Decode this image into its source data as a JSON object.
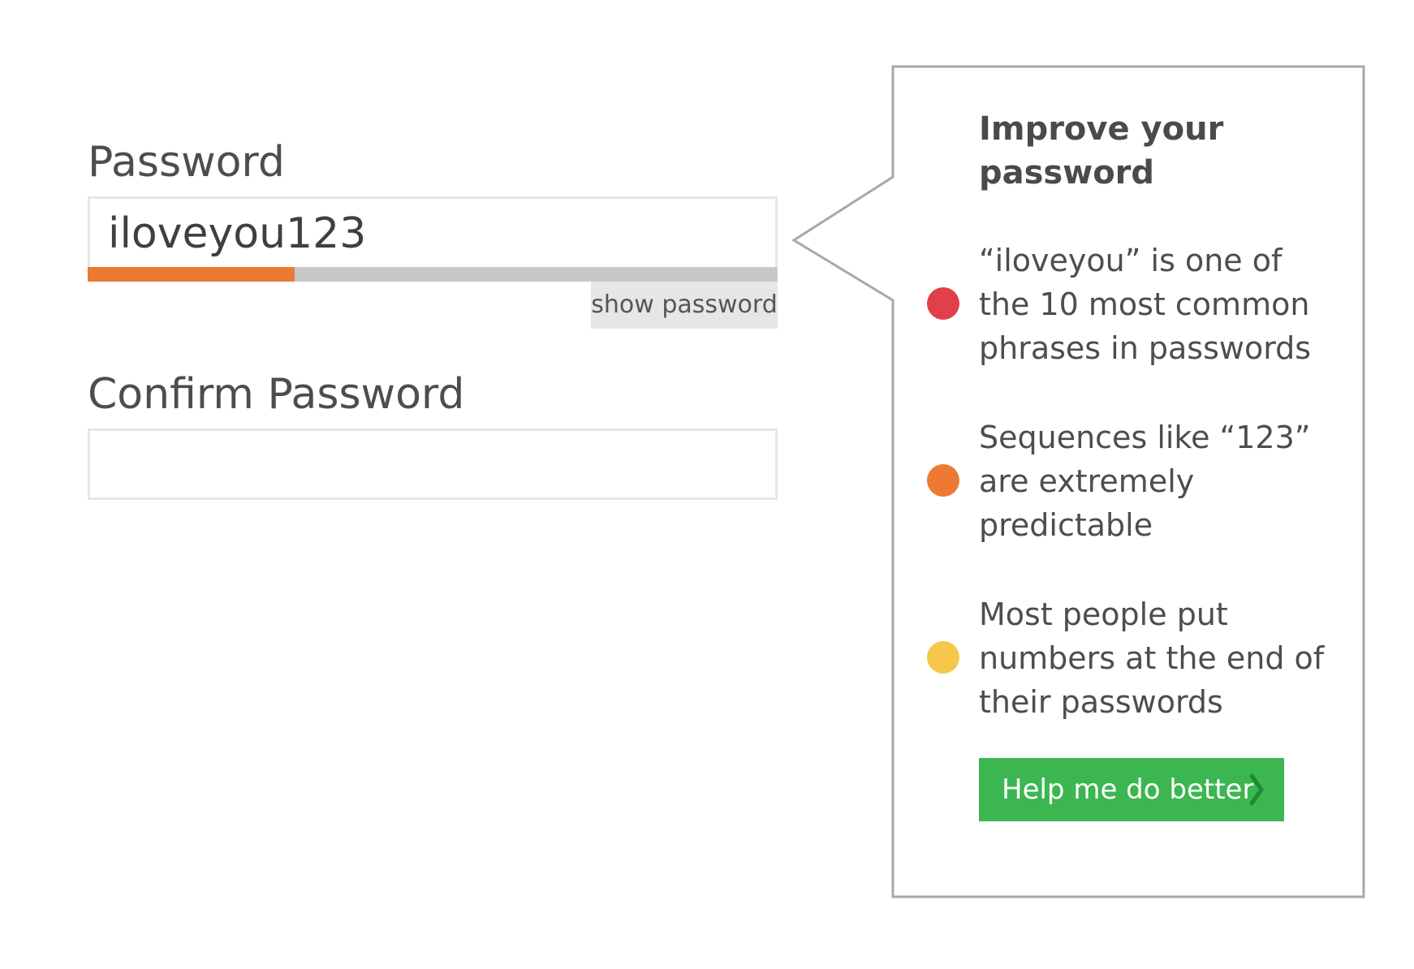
{
  "password": {
    "label": "Password",
    "value": "iloveyou123",
    "strength": 0.3,
    "strength_color": "#ec7a34",
    "track_color": "#c8c8c8",
    "show_label": "show password"
  },
  "confirm": {
    "label": "Confirm Password",
    "value": ""
  },
  "callout": {
    "title": "Improve your password",
    "tips": [
      {
        "text": "“iloveyou” is one of the 10 most common phrases in passwords",
        "color": "#e0404a"
      },
      {
        "text": "Sequences like “123” are extremely predictable",
        "color": "#ec7a34"
      },
      {
        "text": "Most people put numbers at the end of their passwords",
        "color": "#f5c84a"
      }
    ],
    "button_label": "Help me do better",
    "button_color": "#3cb651",
    "button_icon": "chevron-right-icon"
  }
}
